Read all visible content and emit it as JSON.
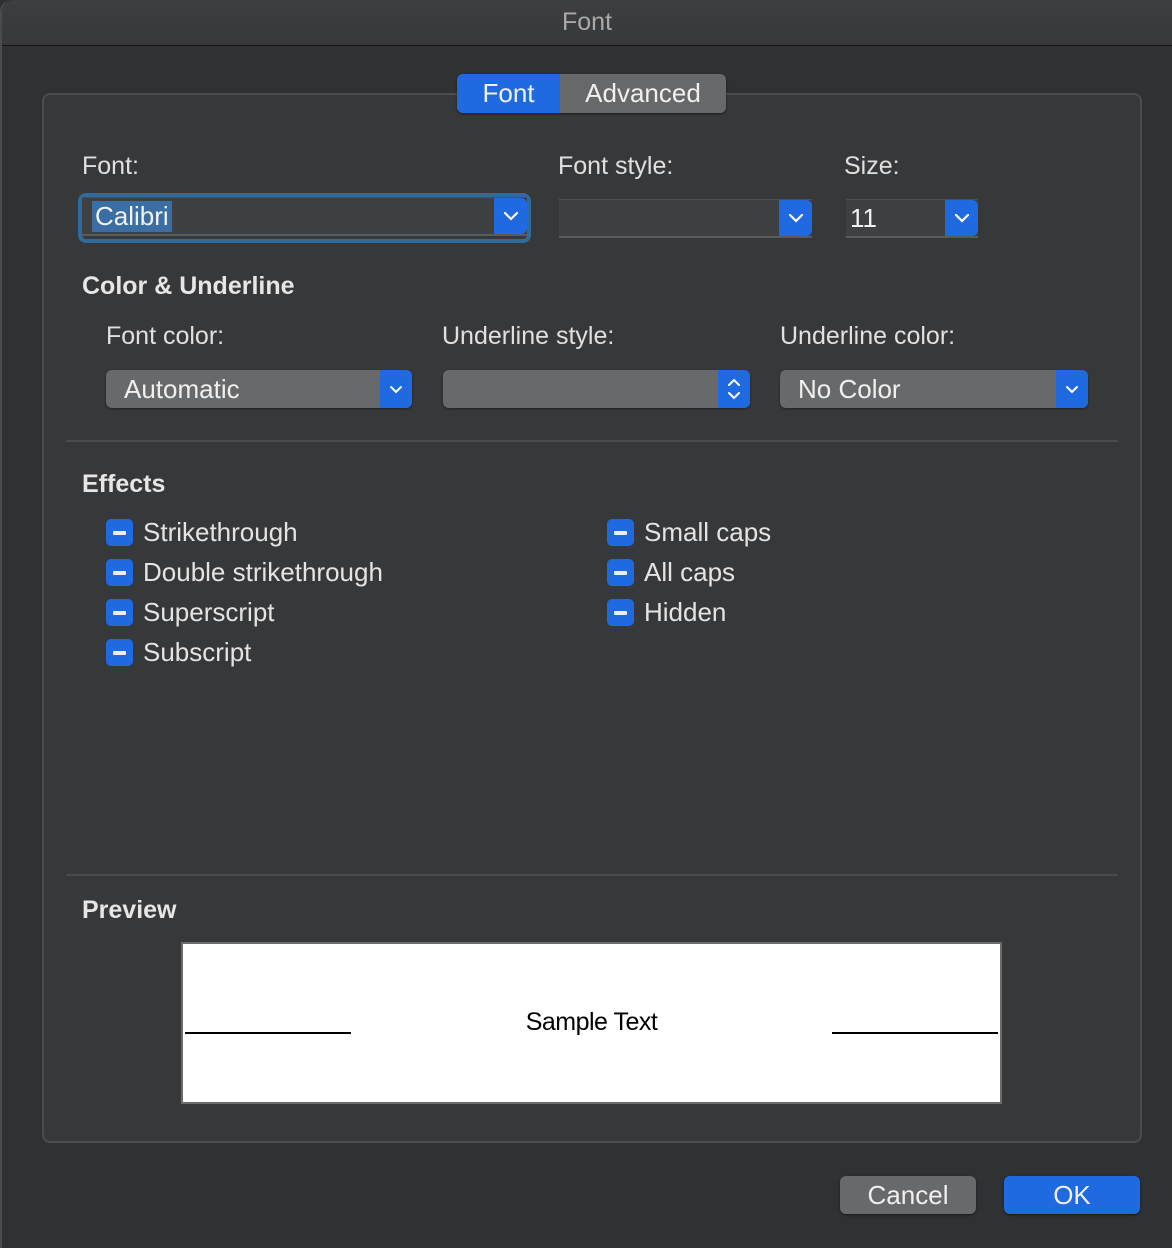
{
  "window": {
    "title": "Font"
  },
  "tabs": [
    {
      "label": "Font",
      "active": true
    },
    {
      "label": "Advanced",
      "active": false
    }
  ],
  "font_fields": {
    "font": {
      "label": "Font:",
      "value": "Calibri"
    },
    "font_style": {
      "label": "Font style:",
      "value": ""
    },
    "size": {
      "label": "Size:",
      "value": "11"
    }
  },
  "color_underline": {
    "heading": "Color & Underline",
    "font_color": {
      "label": "Font color:",
      "value": "Automatic"
    },
    "underline_style": {
      "label": "Underline style:",
      "value": ""
    },
    "underline_color": {
      "label": "Underline color:",
      "value": "No Color"
    }
  },
  "effects": {
    "heading": "Effects",
    "left": [
      {
        "label": "Strikethrough",
        "state": "mixed"
      },
      {
        "label": "Double strikethrough",
        "state": "mixed"
      },
      {
        "label": "Superscript",
        "state": "mixed"
      },
      {
        "label": "Subscript",
        "state": "mixed"
      }
    ],
    "right": [
      {
        "label": "Small caps",
        "state": "mixed"
      },
      {
        "label": "All caps",
        "state": "mixed"
      },
      {
        "label": "Hidden",
        "state": "mixed"
      }
    ]
  },
  "preview": {
    "heading": "Preview",
    "sample_text": "Sample Text"
  },
  "buttons": {
    "cancel": "Cancel",
    "ok": "OK"
  },
  "colors": {
    "accent": "#1f6ae0",
    "background": "#303133",
    "panel": "#37383a"
  }
}
